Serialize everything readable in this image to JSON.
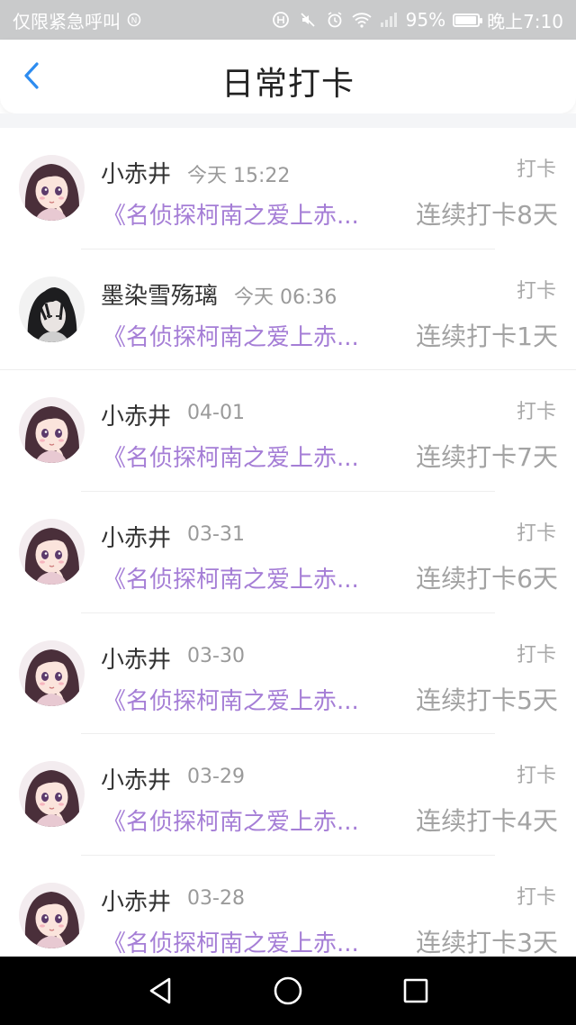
{
  "status_bar": {
    "emergency_text": "仅限紧急呼叫",
    "battery_percent": "95%",
    "battery_level": 0.95,
    "time": "晚上7:10"
  },
  "header": {
    "title": "日常打卡"
  },
  "rows": [
    {
      "name": "小赤井",
      "time": "今天 15:22",
      "tag": "打卡",
      "book": "《名侦探柯南之爱上赤...",
      "streak": "连续打卡8天",
      "avatar": "anime-girl-avatar"
    },
    {
      "name": "墨染雪殇璃",
      "time": "今天 06:36",
      "tag": "打卡",
      "book": "《名侦探柯南之爱上赤...",
      "streak": "连续打卡1天",
      "avatar": "anime-boy-avatar"
    },
    {
      "name": "小赤井",
      "time": "04-01",
      "tag": "打卡",
      "book": "《名侦探柯南之爱上赤...",
      "streak": "连续打卡7天",
      "avatar": "anime-girl-avatar"
    },
    {
      "name": "小赤井",
      "time": "03-31",
      "tag": "打卡",
      "book": "《名侦探柯南之爱上赤...",
      "streak": "连续打卡6天",
      "avatar": "anime-girl-avatar"
    },
    {
      "name": "小赤井",
      "time": "03-30",
      "tag": "打卡",
      "book": "《名侦探柯南之爱上赤...",
      "streak": "连续打卡5天",
      "avatar": "anime-girl-avatar"
    },
    {
      "name": "小赤井",
      "time": "03-29",
      "tag": "打卡",
      "book": "《名侦探柯南之爱上赤...",
      "streak": "连续打卡4天",
      "avatar": "anime-girl-avatar"
    },
    {
      "name": "小赤井",
      "time": "03-28",
      "tag": "打卡",
      "book": "《名侦探柯南之爱上赤...",
      "streak": "连续打卡3天",
      "avatar": "anime-girl-avatar"
    }
  ],
  "nav": {
    "back_icon": "triangle-back-icon",
    "home_icon": "circle-home-icon",
    "recents_icon": "square-recents-icon"
  },
  "colors": {
    "accent_blue": "#2d8cf0",
    "book_purple": "#a57ed6"
  }
}
